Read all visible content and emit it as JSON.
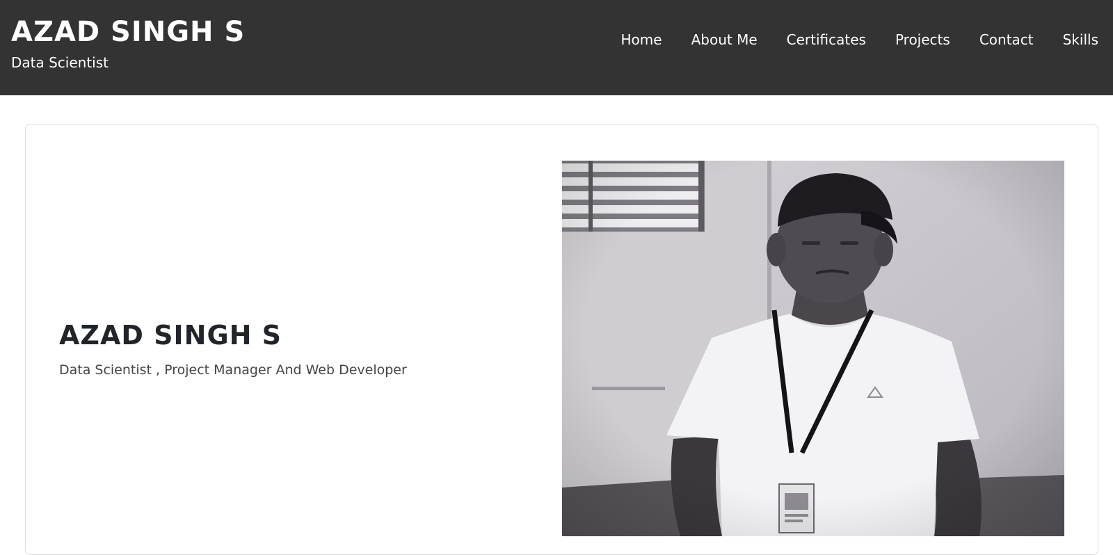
{
  "header": {
    "brand_name": "AZAD SINGH S",
    "brand_role": "Data Scientist",
    "nav": [
      "Home",
      "About Me",
      "Certificates",
      "Projects",
      "Contact",
      "Skills"
    ]
  },
  "hero": {
    "name": "AZAD SINGH S",
    "tagline": "Data Scientist , Project Manager And Web Developer"
  },
  "colors": {
    "header_bg": "#333333",
    "header_text": "#ffffff",
    "hero_text": "#212529"
  },
  "icons": {
    "profile_photo": "profile-photo"
  }
}
